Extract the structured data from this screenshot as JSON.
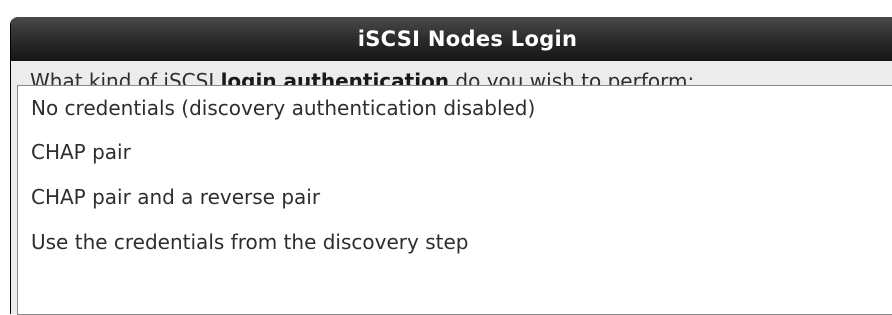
{
  "dialog": {
    "title": "iSCSI Nodes Login",
    "question": {
      "before": "What kind of iSCSI ",
      "bold": "login authentication",
      "after": " do you wish to perform:"
    },
    "options": [
      {
        "label": "No credentials (discovery authentication disabled)"
      },
      {
        "label": "CHAP pair"
      },
      {
        "label": "CHAP pair and a reverse pair"
      },
      {
        "label": "Use the credentials from the discovery step"
      }
    ]
  },
  "colors": {
    "title_bar": "#2c2c2c",
    "dialog_background": "#ececec",
    "list_background": "#ffffff",
    "text": "#2e2e2e"
  }
}
